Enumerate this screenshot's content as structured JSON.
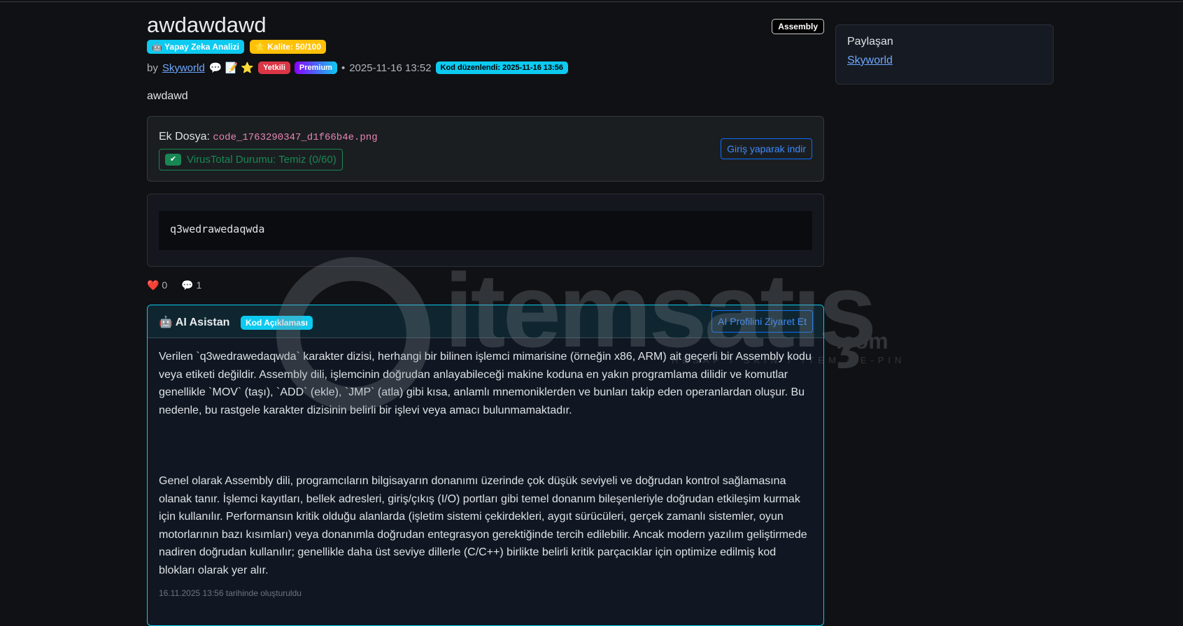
{
  "post": {
    "title": "awdawdawd",
    "language": "Assembly",
    "ai_badge": "🤖 Yapay Zeka Analizi",
    "quality_badge": "⭐ Kalite: 50/100",
    "by": "by",
    "author": "Skyworld",
    "icons": "💬 📝 ⭐",
    "role_badge": "Yetkili",
    "premium_badge": "Premium",
    "separator": "•",
    "date": "2025-11-16 13:52",
    "edited_badge": "Kod düzenlendi: 2025-11-16 13:56",
    "description": "awdawd"
  },
  "attachment": {
    "label": "Ek Dosya:",
    "filename": "code_1763290347_d1f66b4e.png",
    "virus_status": "VirusTotal Durumu: Temiz (0/60)",
    "download_button": "Giriş yaparak indir"
  },
  "code": "q3wedrawedaqwda",
  "stats": {
    "likes": "0",
    "comments": "1"
  },
  "ai": {
    "title": "🤖 AI Asistan",
    "badge": "Kod Açıklaması",
    "profile_button": "AI Profilini Ziyaret Et",
    "paragraphs": [
      "Verilen `q3wedrawedaqwda` karakter dizisi, herhangi bir bilinen işlemci mimarisine (örneğin x86, ARM) ait geçerli bir Assembly kodu veya etiketi değildir. Assembly dili, işlemcinin doğrudan anlayabileceği makine koduna en yakın programlama dilidir ve komutlar genellikle `MOV` (taşı), `ADD` (ekle), `JMP` (atla) gibi kısa, anlamlı mnemoniklerden ve bunları takip eden operanlardan oluşur. Bu nedenle, bu rastgele karakter dizisinin belirli bir işlevi veya amacı bulunmamaktadır.",
      "Genel olarak Assembly dili, programcıların bilgisayarın donanımı üzerinde çok düşük seviyeli ve doğrudan kontrol sağlamasına olanak tanır. İşlemci kayıtları, bellek adresleri, giriş/çıkış (I/O) portları gibi temel donanım bileşenleriyle doğrudan etkileşim kurmak için kullanılır. Performansın kritik olduğu alanlarda (işletim sistemi çekirdekleri, aygıt sürücüleri, gerçek zamanlı sistemler, oyun motorlarının bazı kısımları) veya donanımla doğrudan entegrasyon gerektiğinde tercih edilebilir. Ancak modern yazılım geliştirmede nadiren doğrudan kullanılır; genellikle daha üst seviye dillerle (C/C++) birlikte belirli kritik parçacıklar için optimize edilmiş kod blokları olarak yer alır."
    ],
    "footer": "16.11.2025 13:56 tarihinde oluşturuldu"
  },
  "sidebar": {
    "heading": "Paylaşan",
    "user": "Skyworld"
  },
  "watermark": {
    "brand": "itemsatış",
    "tld": ".com",
    "tagline": "HESAP / SKIN / ITEM / E-PIN"
  }
}
